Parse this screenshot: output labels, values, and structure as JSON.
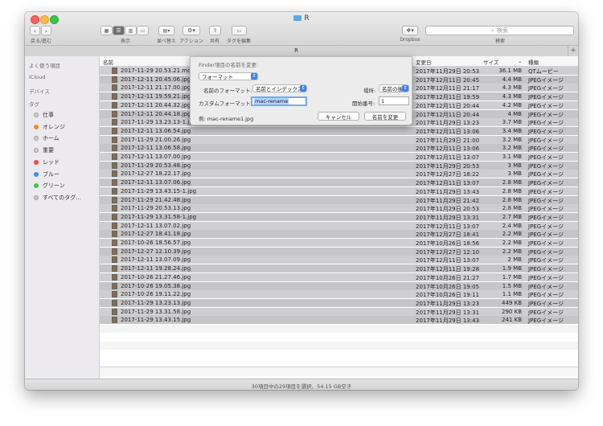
{
  "window": {
    "title": "R"
  },
  "toolbar": {
    "back_forward_label": "戻る/進む",
    "view_label": "表示",
    "arrange_label": "並べ替え",
    "action_label": "アクション",
    "share_label": "共有",
    "edit_tags_label": "タグを編集",
    "dropbox_label": "Dropbox",
    "search_label": "検索",
    "search_placeholder": "検索"
  },
  "tab": {
    "title": "R",
    "add_label": "+"
  },
  "sidebar": {
    "favorites_label": "よく使う項目",
    "icloud_label": "iCloud",
    "devices_label": "デバイス",
    "tags_label": "タグ",
    "tags": [
      {
        "name": "仕事",
        "color": "#d0d0d0"
      },
      {
        "name": "オレンジ",
        "color": "#f28c28"
      },
      {
        "name": "ホーム",
        "color": "#d0d0d0"
      },
      {
        "name": "重要",
        "color": "#d0d0d0"
      },
      {
        "name": "レッド",
        "color": "#f04a4a"
      },
      {
        "name": "ブルー",
        "color": "#2f95f5"
      },
      {
        "name": "グリーン",
        "color": "#4bc248"
      },
      {
        "name": "すべてのタグ…",
        "color": "#c8c8c8"
      }
    ]
  },
  "columns": {
    "name": "名前",
    "modified": "変更日",
    "size": "サイズ",
    "kind": "種類"
  },
  "files": [
    {
      "name": "2017-11-29 20.53.21.mov",
      "date": "2017年11月29日 20:53",
      "size": "36.1 MB",
      "kind": "QTムービー"
    },
    {
      "name": "2017-12-11 20.45.06.jpg",
      "date": "2017年12月11日 20:45",
      "size": "4.4 MB",
      "kind": "JPEGイメージ"
    },
    {
      "name": "2017-12-11 21.17.00.jpg",
      "date": "2017年12月11日 21:17",
      "size": "4.3 MB",
      "kind": "JPEGイメージ"
    },
    {
      "name": "2017-12-11 19.59.21.jpg",
      "date": "2017年12月11日 19:59",
      "size": "4.3 MB",
      "kind": "JPEGイメージ"
    },
    {
      "name": "2017-12-11 20.44.32.jpg",
      "date": "2017年12月11日 20:44",
      "size": "4.2 MB",
      "kind": "JPEGイメージ"
    },
    {
      "name": "2017-12-11 20.44.18.jpg",
      "date": "2017年12月11日 20:44",
      "size": "4 MB",
      "kind": "JPEGイメージ"
    },
    {
      "name": "2017-11-29 13.23.13-1.jpg",
      "date": "2017年11月29日 13:23",
      "size": "3.7 MB",
      "kind": "JPEGイメージ"
    },
    {
      "name": "2017-12-11 13.06.54.jpg",
      "date": "2017年12月11日 13:06",
      "size": "3.4 MB",
      "kind": "JPEGイメージ"
    },
    {
      "name": "2017-11-29 21.00.26.jpg",
      "date": "2017年11月29日 21:00",
      "size": "3.2 MB",
      "kind": "JPEGイメージ"
    },
    {
      "name": "2017-12-11 13.06.58.jpg",
      "date": "2017年12月11日 13:06",
      "size": "3.2 MB",
      "kind": "JPEGイメージ"
    },
    {
      "name": "2017-12-11 13.07.00.jpg",
      "date": "2017年12月11日 13:07",
      "size": "3.1 MB",
      "kind": "JPEGイメージ"
    },
    {
      "name": "2017-11-29 20.53.48.jpg",
      "date": "2017年11月29日 20:53",
      "size": "3 MB",
      "kind": "JPEGイメージ"
    },
    {
      "name": "2017-12-27 18.22.17.jpg",
      "date": "2017年12月27日 18:22",
      "size": "3 MB",
      "kind": "JPEGイメージ"
    },
    {
      "name": "2017-12-11 13.07.06.jpg",
      "date": "2017年12月11日 13:07",
      "size": "2.8 MB",
      "kind": "JPEGイメージ"
    },
    {
      "name": "2017-11-29 13.43.15-1.jpg",
      "date": "2017年11月29日 13:43",
      "size": "2.8 MB",
      "kind": "JPEGイメージ"
    },
    {
      "name": "2017-11-29 21.42.48.jpg",
      "date": "2017年11月29日 21:42",
      "size": "2.8 MB",
      "kind": "JPEGイメージ"
    },
    {
      "name": "2017-11-29 20.53.13.jpg",
      "date": "2017年11月29日 20:53",
      "size": "2.8 MB",
      "kind": "JPEGイメージ"
    },
    {
      "name": "2017-11-29 13.31.58-1.jpg",
      "date": "2017年11月29日 13:31",
      "size": "2.7 MB",
      "kind": "JPEGイメージ"
    },
    {
      "name": "2017-12-11 13.07.02.jpg",
      "date": "2017年12月11日 13:07",
      "size": "2.4 MB",
      "kind": "JPEGイメージ"
    },
    {
      "name": "2017-12-27 18.41.18.jpg",
      "date": "2017年12月27日 18:41",
      "size": "2.2 MB",
      "kind": "JPEGイメージ"
    },
    {
      "name": "2017-10-26 18.56.57.jpg",
      "date": "2017年10月26日 18:56",
      "size": "2.2 MB",
      "kind": "JPEGイメージ"
    },
    {
      "name": "2017-12-27 12.10.39.jpg",
      "date": "2017年12月27日 12:10",
      "size": "2.2 MB",
      "kind": "JPEGイメージ"
    },
    {
      "name": "2017-12-11 13.07.09.jpg",
      "date": "2017年12月11日 13:07",
      "size": "2 MB",
      "kind": "JPEGイメージ"
    },
    {
      "name": "2017-12-11 19.28.24.jpg",
      "date": "2017年12月11日 19:28",
      "size": "1.9 MB",
      "kind": "JPEGイメージ"
    },
    {
      "name": "2017-10-26 21.27.46.jpg",
      "date": "2017年10月26日 21:27",
      "size": "1.7 MB",
      "kind": "JPEGイメージ"
    },
    {
      "name": "2017-10-26 19.05.38.jpg",
      "date": "2017年10月26日 19:05",
      "size": "1.5 MB",
      "kind": "JPEGイメージ"
    },
    {
      "name": "2017-10-26 19.11.22.jpg",
      "date": "2017年10月26日 19:11",
      "size": "1.1 MB",
      "kind": "JPEGイメージ"
    },
    {
      "name": "2017-11-29 13.23.13.jpg",
      "date": "2017年11月29日 13:23",
      "size": "449 KB",
      "kind": "JPEGイメージ"
    },
    {
      "name": "2017-11-29 13.31.58.jpg",
      "date": "2017年11月29日 13:31",
      "size": "290 KB",
      "kind": "JPEGイメージ"
    },
    {
      "name": "2017-11-29 13.43.15.jpg",
      "date": "2017年11月29日 13:43",
      "size": "241 KB",
      "kind": "JPEGイメージ"
    }
  ],
  "status": {
    "text": "30項目中の29項目を選択、54.15 GB空き"
  },
  "rename_sheet": {
    "title": "Finder項目の名前を変更:",
    "mode": "フォーマット",
    "name_format_label": "名前のフォーマット:",
    "name_format_value": "名前とインデックス",
    "where_label": "場所:",
    "where_value": "名前の後",
    "custom_format_label": "カスタムフォーマット:",
    "custom_format_value": "mac-rename",
    "start_number_label": "開始番号:",
    "start_number_value": "1",
    "example": "例: mac-rename1.jpg",
    "cancel_label": "キャンセル",
    "rename_label": "名前を変更"
  }
}
